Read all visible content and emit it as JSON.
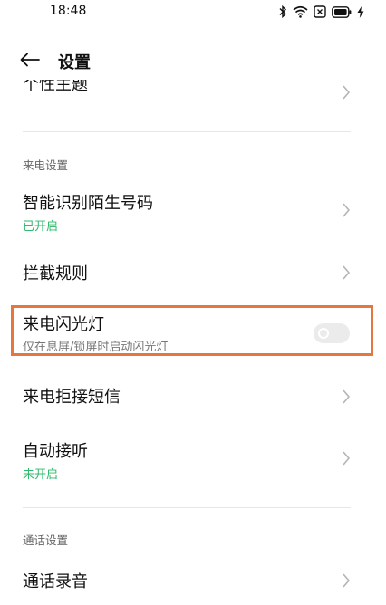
{
  "status_bar": {
    "time": "18:48",
    "icons": [
      "bluetooth-icon",
      "wifi-icon",
      "nfc-icon",
      "battery-icon",
      "charging-bolt-icon"
    ]
  },
  "header": {
    "title": "设置",
    "back_icon": "back-arrow-icon"
  },
  "list": {
    "partial_item": {
      "title": "个性主题"
    },
    "incoming_call_section": {
      "header": "来电设置",
      "items": [
        {
          "title": "智能识别陌生号码",
          "status": "已开启"
        },
        {
          "title": "拦截规则"
        },
        {
          "title": "来电闪光灯",
          "subtitle": "仅在息屏/锁屏时启动闪光灯",
          "toggle_on": false
        },
        {
          "title": "来电拒接短信"
        },
        {
          "title": "自动接听",
          "status": "未开启"
        }
      ]
    },
    "call_section": {
      "header": "通话设置",
      "items": [
        {
          "title": "通话录音"
        }
      ]
    }
  },
  "colors": {
    "status_green": "#2fba6c",
    "highlight_orange": "#e4773f",
    "chevron_gray": "#b5b5b5"
  }
}
